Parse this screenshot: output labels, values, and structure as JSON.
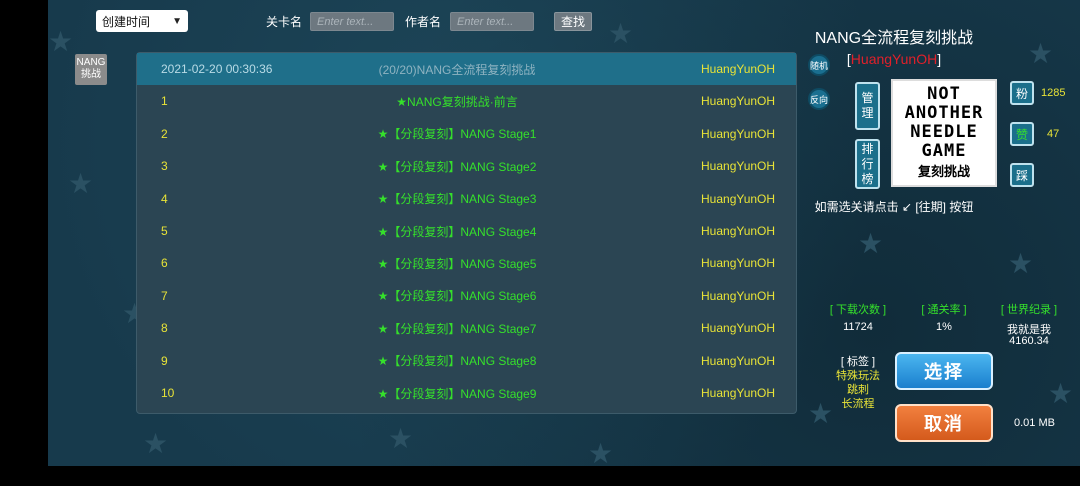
{
  "toolbar": {
    "sort_value": "创建时间",
    "level_name_label": "关卡名",
    "level_name_placeholder": "Enter text...",
    "author_label": "作者名",
    "author_placeholder": "Enter text...",
    "search_label": "查找"
  },
  "side_tag": "NANG 挑战",
  "list": {
    "header": {
      "date": "2021-02-20 00:30:36",
      "title": "(20/20)NANG全流程复刻挑战",
      "author": "HuangYunOH"
    },
    "rows": [
      {
        "idx": "1",
        "title": "★NANG复刻挑战·前言",
        "author": "HuangYunOH"
      },
      {
        "idx": "2",
        "title": "★【分段复刻】NANG Stage1",
        "author": "HuangYunOH"
      },
      {
        "idx": "3",
        "title": "★【分段复刻】NANG Stage2",
        "author": "HuangYunOH"
      },
      {
        "idx": "4",
        "title": "★【分段复刻】NANG Stage3",
        "author": "HuangYunOH"
      },
      {
        "idx": "5",
        "title": "★【分段复刻】NANG Stage4",
        "author": "HuangYunOH"
      },
      {
        "idx": "6",
        "title": "★【分段复刻】NANG Stage5",
        "author": "HuangYunOH"
      },
      {
        "idx": "7",
        "title": "★【分段复刻】NANG Stage6",
        "author": "HuangYunOH"
      },
      {
        "idx": "8",
        "title": "★【分段复刻】NANG Stage7",
        "author": "HuangYunOH"
      },
      {
        "idx": "9",
        "title": "★【分段复刻】NANG Stage8",
        "author": "HuangYunOH"
      },
      {
        "idx": "10",
        "title": "★【分段复刻】NANG Stage9",
        "author": "HuangYunOH"
      }
    ]
  },
  "side_buttons": {
    "random": "随机",
    "reverse": "反向"
  },
  "detail": {
    "title": "NANG全流程复刻挑战",
    "author_open": "[",
    "author": "HuangYunOH",
    "author_close": "]",
    "manage": "管理",
    "leaderboard": "排行榜",
    "thumb_lines": [
      "NOT",
      "ANOTHER",
      "NEEDLE",
      "GAME"
    ],
    "thumb_sub": "复刻挑战",
    "fans_label": "粉",
    "fans_count": "1285",
    "like_label": "赞",
    "like_count": "47",
    "dislike_label": "踩",
    "hint": "如需选关请点击 ↙ [往期] 按钮",
    "stats": {
      "downloads_label": "[ 下载次数 ]",
      "downloads": "11724",
      "clear_rate_label": "[ 通关率 ]",
      "clear_rate": "1%",
      "record_label": "[ 世界纪录 ]",
      "record_holder": "我就是我",
      "record_time": "4160.34"
    },
    "tags_label": "[ 标签 ]",
    "tags": [
      "特殊玩法",
      "跳刺",
      "长流程"
    ],
    "select_label": "选择",
    "cancel_label": "取消",
    "file_size": "0.01 MB"
  },
  "colors": {
    "bg": "#173a4c",
    "panel": "#2b4553",
    "header_row": "#1f6f8a",
    "green": "#35e02b",
    "yellow": "#e8e337",
    "red": "#e0202a"
  }
}
